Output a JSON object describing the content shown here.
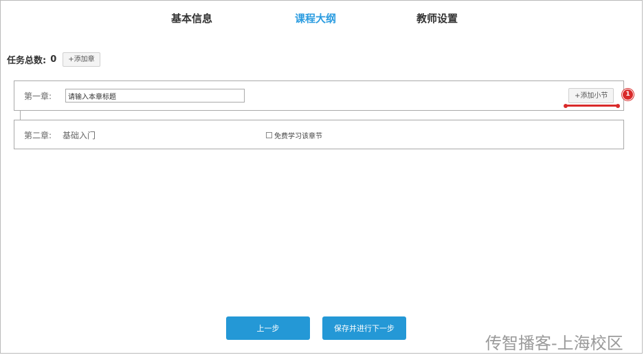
{
  "tabs": [
    {
      "label": "基本信息",
      "active": false
    },
    {
      "label": "课程大纲",
      "active": true
    },
    {
      "label": "教师设置",
      "active": false
    }
  ],
  "tasks": {
    "label": "任务总数:",
    "count": "0",
    "add_chapter_label": "+添加章"
  },
  "chapters": [
    {
      "label": "第一章:",
      "title_input_value": "请输入本章标题",
      "add_section_label": "+添加小节"
    },
    {
      "label": "第二章:",
      "title": "基础入门",
      "free_checkbox_label": "免费学习该章节",
      "free_checked": false
    }
  ],
  "annotation": {
    "badge": "1",
    "color": "#d92a2a"
  },
  "footer": {
    "prev_label": "上一步",
    "next_label": "保存并进行下一步"
  },
  "watermark": "传智播客-上海校区",
  "colors": {
    "accent": "#2b9ce0",
    "button": "#2498d6"
  }
}
